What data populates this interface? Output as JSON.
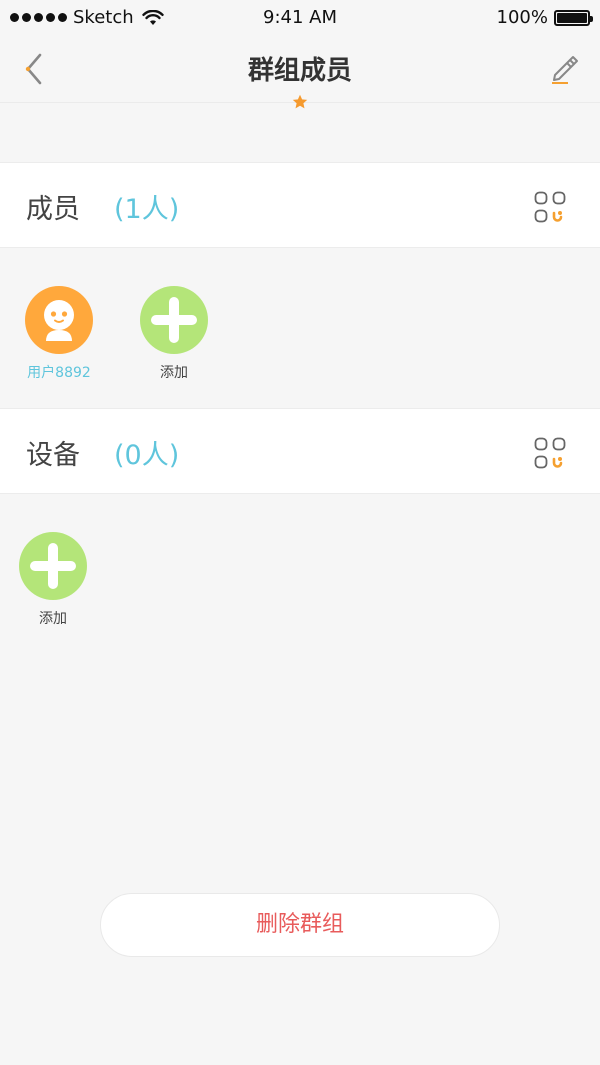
{
  "status_bar": {
    "carrier": "Sketch",
    "time": "9:41 AM",
    "battery": "100%"
  },
  "nav": {
    "title": "群组成员"
  },
  "members_section": {
    "title": "成员",
    "count": "(1人)",
    "items": [
      {
        "label": "用户8892"
      },
      {
        "label": "添加"
      }
    ]
  },
  "devices_section": {
    "title": "设备",
    "count": "(0人)",
    "items": [
      {
        "label": "添加"
      }
    ]
  },
  "delete_button": {
    "label": "删除群组"
  },
  "colors": {
    "accent_blue": "#5fc5dc",
    "avatar_orange": "#ffa83c",
    "add_green": "#b4e579",
    "danger_red": "#e85b5b",
    "star_orange": "#f59a2e"
  },
  "icons": [
    "signal-icon",
    "wifi-icon",
    "battery-icon",
    "back-chevron-icon",
    "star-icon",
    "edit-pencil-icon",
    "grid-menu-icon",
    "user-avatar-icon",
    "plus-icon"
  ]
}
